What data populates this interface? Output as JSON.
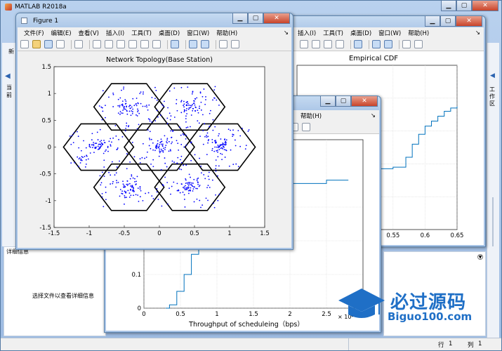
{
  "main_window": {
    "title": "MATLAB R2018a",
    "right_tab_label": "工作区",
    "left_partial_label_1": "新",
    "left_partial_label_2": "当前",
    "details_panel": {
      "header": "详细信息",
      "message": "选择文件以查看详细信息"
    },
    "statusbar": {
      "row_label": "行",
      "row_value": "1",
      "col_label": "列",
      "col_value": "1"
    }
  },
  "window_controls": {
    "minimize": "▁",
    "maximize": "▢",
    "close": "✕"
  },
  "figure1": {
    "title": "Figure 1",
    "menu": [
      "文件(F)",
      "编辑(E)",
      "查看(V)",
      "插入(I)",
      "工具(T)",
      "桌面(D)",
      "窗口(W)",
      "帮助(H)"
    ],
    "menu_arrow": "↘"
  },
  "figure_cdf": {
    "menu": [
      "插入(I)",
      "工具(T)",
      "桌面(D)",
      "窗口(W)",
      "帮助(H)"
    ],
    "menu_arrow": "↘"
  },
  "figure_throughput": {
    "menu": [
      "帮助(H)"
    ],
    "menu_arrow": "↘"
  },
  "watermark": {
    "cn": "必过源码",
    "en": "Biguo100.com"
  },
  "chart_data": [
    {
      "type": "scatter",
      "title": "Network Topology(Base Station)",
      "xlabel": "",
      "ylabel": "",
      "xlim": [
        -1.5,
        1.5
      ],
      "ylim": [
        -1.5,
        1.5
      ],
      "xticks": [
        "-1.5",
        "-1",
        "-0.5",
        "0",
        "0.5",
        "1",
        "1.5"
      ],
      "yticks": [
        "1.5",
        "1",
        "0.5",
        "0",
        "-0.5",
        "-1",
        "-1.5"
      ],
      "cell_centers": [
        [
          0,
          0
        ],
        [
          0.433,
          0.75
        ],
        [
          -0.433,
          0.75
        ],
        [
          -0.866,
          0
        ],
        [
          0.866,
          0
        ],
        [
          -0.433,
          -0.75
        ],
        [
          0.433,
          -0.75
        ]
      ],
      "cell_radius": 0.5,
      "users_per_cell": 100,
      "point_color": "#0000ff",
      "hex_color": "#000000"
    },
    {
      "type": "line",
      "title": "Empirical CDF",
      "xlabel": "",
      "ylabel": "",
      "visible_xticks": [
        "0.55",
        "0.6",
        "0.65"
      ],
      "x": [
        0.53,
        0.55,
        0.57,
        0.58,
        0.59,
        0.6,
        0.61,
        0.62,
        0.63,
        0.64,
        0.65
      ],
      "y": [
        0.37,
        0.38,
        0.44,
        0.52,
        0.58,
        0.63,
        0.66,
        0.69,
        0.72,
        0.74,
        0.75
      ],
      "color": "#0072bd"
    },
    {
      "type": "line",
      "title": "",
      "xlabel": "Throughput of scheduleing（bps）",
      "x_exponent": "× 10⁴",
      "xlim": [
        0,
        3
      ],
      "xticks": [
        "0",
        "0.5",
        "1",
        "1.5",
        "2",
        "2.5"
      ],
      "visible_yticks": [
        "0.3",
        "0.2",
        "0.1",
        "0"
      ],
      "x": [
        0.3,
        0.35,
        0.45,
        0.55,
        0.65,
        0.75,
        1.0,
        1.3,
        1.6,
        2.0,
        2.5,
        2.8
      ],
      "y": [
        0.0,
        0.01,
        0.05,
        0.1,
        0.16,
        0.22,
        0.28,
        0.32,
        0.35,
        0.37,
        0.38,
        0.38
      ],
      "color": "#0072bd"
    }
  ]
}
